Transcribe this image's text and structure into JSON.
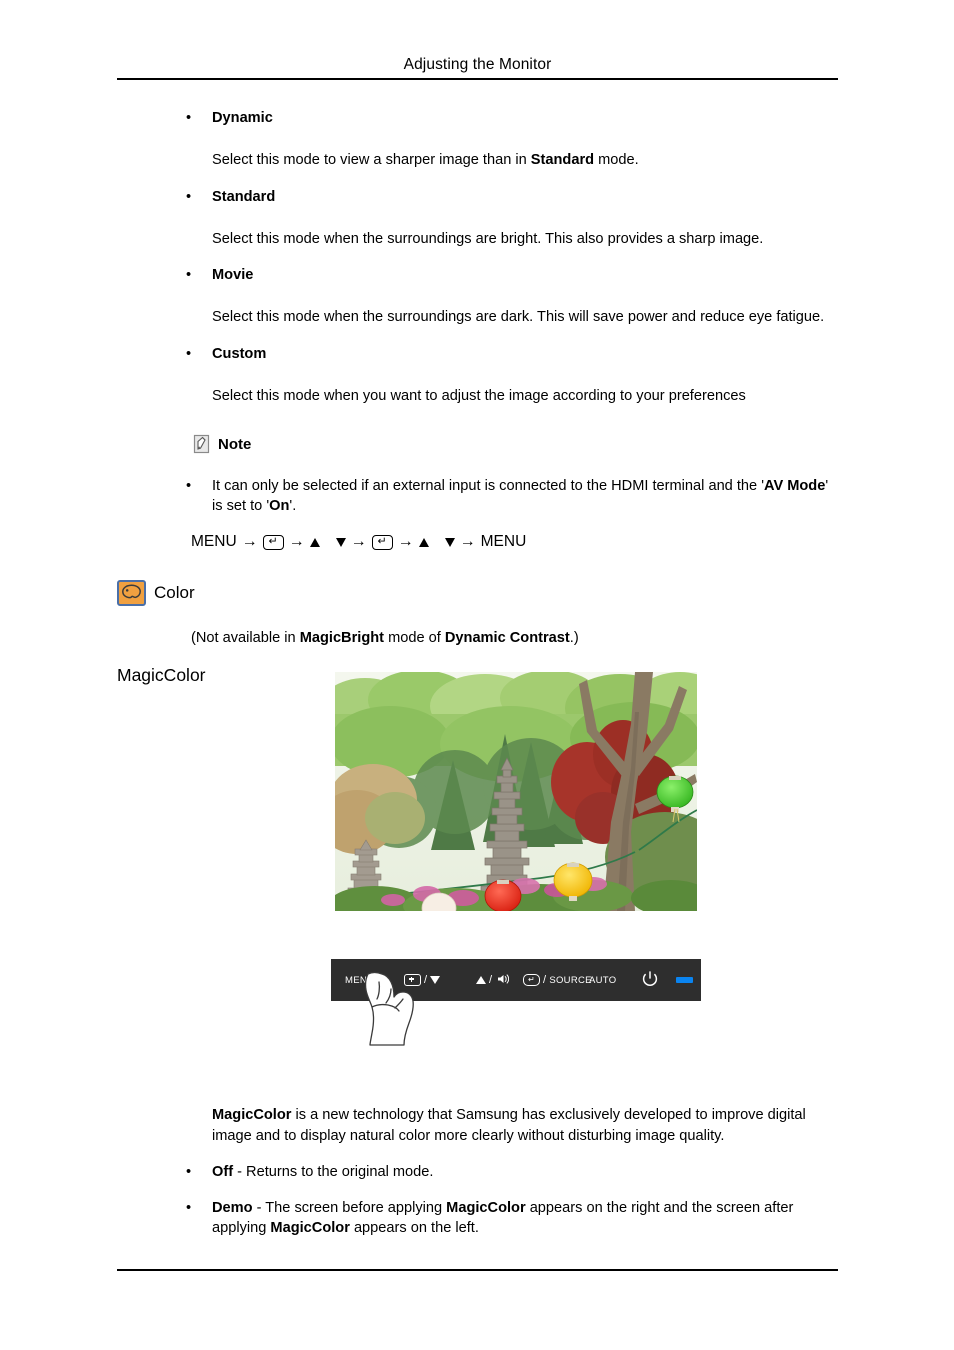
{
  "header": {
    "title": "Adjusting the Monitor"
  },
  "modes": [
    {
      "term": "Dynamic",
      "desc_before": "Select this mode to view a sharper image than in ",
      "desc_bold": "Standard",
      "desc_after": " mode."
    },
    {
      "term": "Standard",
      "desc_before": "Select this mode when the surroundings are bright. This also provides a sharp image.",
      "desc_bold": "",
      "desc_after": ""
    },
    {
      "term": "Movie",
      "desc_before": "Select this mode when the surroundings are dark. This will save power and reduce eye fatigue.",
      "desc_bold": "",
      "desc_after": ""
    },
    {
      "term": "Custom",
      "desc_before": "Select this mode when you want to adjust the image according to your preferences",
      "desc_bold": "",
      "desc_after": ""
    }
  ],
  "note": {
    "label": "Note",
    "icon": "note-pencil-icon",
    "bullet_part1": "It can only be selected if an external input is connected to the HDMI terminal and the '",
    "bullet_bold1": "AV Mode",
    "bullet_part2": "' is set to '",
    "bullet_bold2": "On",
    "bullet_part3": "'."
  },
  "menu_path": {
    "start": "MENU",
    "end": "MENU",
    "arrow": "→",
    "enter_icon": "enter-key-icon",
    "up_icon": "triangle-up-icon",
    "down_icon": "triangle-down-icon"
  },
  "color_section": {
    "icon": "color-palette-icon",
    "icon_bg": "#f0a040",
    "icon_border": "#4a6fa8",
    "title": "Color",
    "note_part1": "(Not available in ",
    "note_bold1": "MagicBright",
    "note_part2": " mode of ",
    "note_bold2": "Dynamic Contrast",
    "note_part3": ".)",
    "subheading": "MagicColor"
  },
  "photo": {
    "alt": "Korean temple garden with stone pagodas, paper lanterns and trees",
    "name": "magiccolor-sample-photo"
  },
  "control_bar": {
    "background": "#2e2e2e",
    "led_color": "#0a84f0",
    "buttons": [
      {
        "name": "menu-button",
        "label": "MENU"
      },
      {
        "name": "brightness-down-button",
        "label": "",
        "separator": "/"
      },
      {
        "name": "volume-up-button",
        "label": "",
        "separator": "/"
      },
      {
        "name": "enter-source-button",
        "label": "SOURCE",
        "separator": "/"
      },
      {
        "name": "auto-button",
        "label": "AUTO"
      },
      {
        "name": "power-button",
        "label": ""
      },
      {
        "name": "power-led",
        "label": ""
      }
    ],
    "hand_pointer": "hand-pressing-menu"
  },
  "magiccolor_body": {
    "bold_lead": "MagicColor",
    "text": " is a new technology that Samsung has exclusively developed to improve digital image and to display natural color more clearly without disturbing image quality.",
    "options": [
      {
        "term": "Off",
        "part1": " - Returns to the original mode.",
        "bold1": "",
        "part2": "",
        "bold2": "",
        "part3": ""
      },
      {
        "term": "Demo",
        "part1": " - The screen before applying ",
        "bold1": "MagicColor",
        "part2": " appears on the right and the screen after applying ",
        "bold2": "MagicColor",
        "part3": " appears on the left."
      }
    ]
  }
}
